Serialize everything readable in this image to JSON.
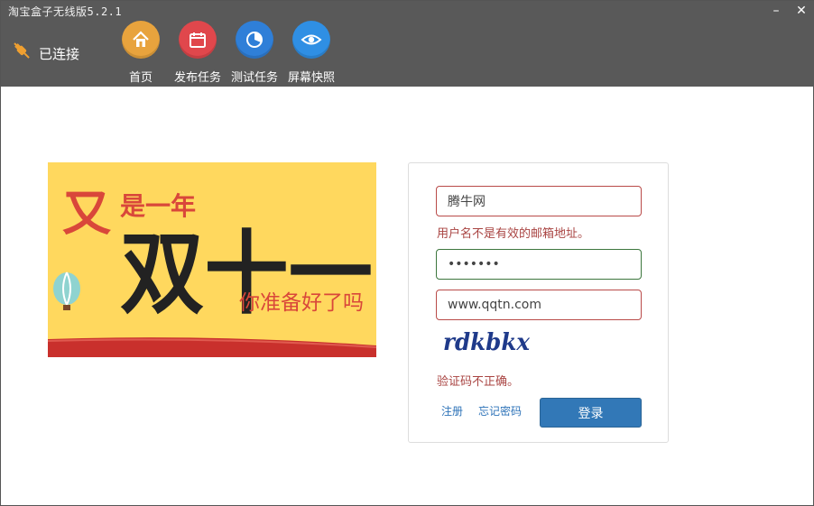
{
  "window": {
    "title": "淘宝盒子无线版5.2.1",
    "minimize_glyph": "–",
    "close_glyph": "✕"
  },
  "status": {
    "text": "已连接",
    "icon": "plug-icon"
  },
  "nav": [
    {
      "label": "首页",
      "icon": "home-icon",
      "color": "#e8a33d"
    },
    {
      "label": "发布任务",
      "icon": "calendar-icon",
      "color": "#e0474c"
    },
    {
      "label": "测试任务",
      "icon": "pie-chart-icon",
      "color": "#2f7fd8"
    },
    {
      "label": "屏幕快照",
      "icon": "eye-icon",
      "color": "#2f8fe4"
    }
  ],
  "banner": {
    "line1_a": "又",
    "line1_b": "是一年",
    "headline": "双十一",
    "subtitle": "你准备好了吗",
    "icon": "hot-air-balloon-icon"
  },
  "login": {
    "username_value": "腾牛网",
    "username_error": "用户名不是有效的邮箱地址。",
    "password_value": "1234567",
    "captcha_value": "www.qqtn.com",
    "captcha_image_text": "rdkbkx",
    "captcha_error": "验证码不正确。",
    "register_label": "注册",
    "forgot_label": "忘记密码",
    "login_button": "登录"
  },
  "colors": {
    "topbar": "#595959",
    "banner_bg": "#ffd85e",
    "error": "#a94442",
    "ok_border": "#3c763d",
    "primary": "#3278b7"
  }
}
